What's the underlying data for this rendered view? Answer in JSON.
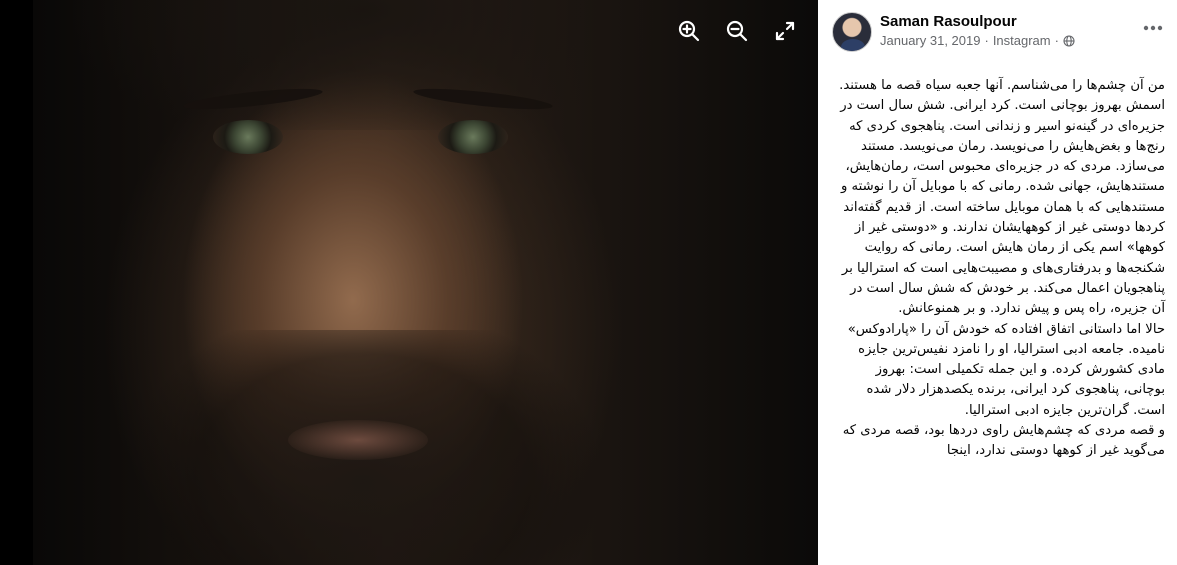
{
  "post": {
    "author": "Saman Rasoulpour",
    "date": "January 31, 2019",
    "source": "Instagram",
    "separator": "·",
    "text": "من آن چشم‌ها را می‌شناسم. آنها جعبه سیاه قصه ما هستند. اسمش بهروز بوچانی است. کرد ایرانی. شش سال است در جزیره‌ای در گینه‌نو اسیر و زندانی است. پناهجوی کردی که رنج‌ها و بغض‌هایش را می‌نویسد. رمان می‌نویسد. مستند می‌سازد. مردی که در جزیره‌ای محبوس است، رمان‌هایش، مستندهایش، جهانی شده. رمانی که با موبایل آن را نوشته و مستندهایی که با همان موبایل ساخته است. از قدیم گفته‌اند کردها دوستی غیر از کوههایشان ندارند. و «دوستی غیر از کوهها» اسم یکی از رمان هایش است. رمانی که روایت شکنجه‌ها و بدرفتاری‌های و مصیبت‌هایی است که استرالیا بر پناهجویان اعمال می‌کند. بر خودش که شش سال است در آن جزیره، راه پس و پیش ندارد. و بر همنوعانش.\nحالا اما داستانی اتفاق افتاده که خودش آن را «پارادوکس» نامیده. جامعه ادبی استرالیا، او را نامزد نفیس‌ترین جایزه مادی کشورش کرده. و این جمله تکمیلی است: بهروز بوچانی، پناهجوی کرد ایرانی، برنده یکصدهزار دلار شده است. گران‌ترین جایزه ادبی استرالیا.\nو قصه مردی که چشم‌هایش راوی دردها بود، قصه مردی که می‌گوید غیر از کوهها دوستی ندارد، اینجا"
  },
  "viewer": {
    "zoom_in_icon": "zoom-in-icon",
    "zoom_out_icon": "zoom-out-icon",
    "fullscreen_icon": "fullscreen-icon"
  },
  "colors": {
    "photo_bg": "#000000",
    "text": "#050505",
    "secondary_text": "#65676b"
  }
}
